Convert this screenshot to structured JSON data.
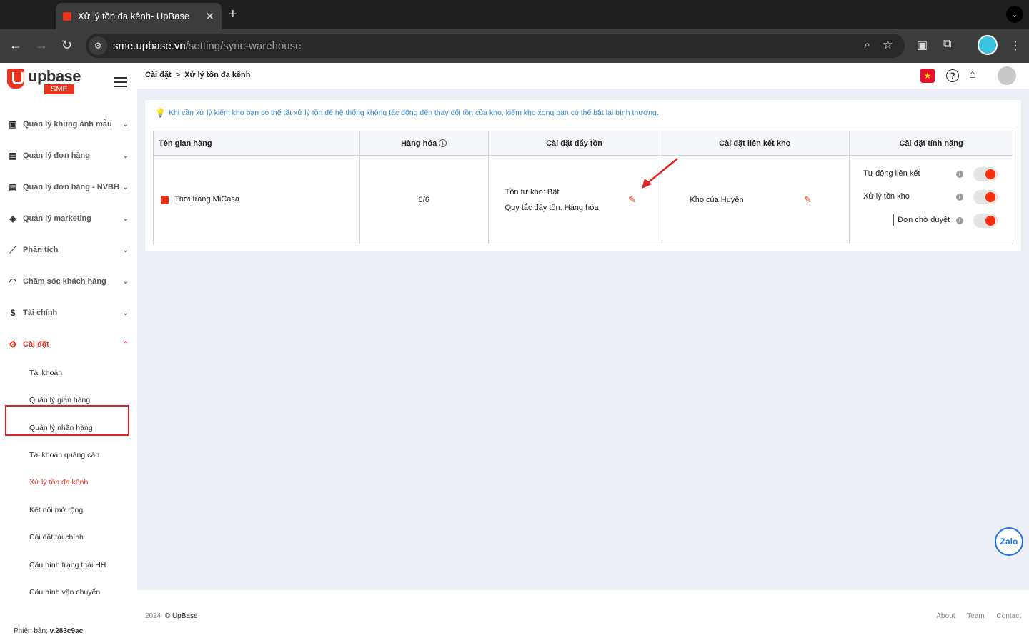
{
  "browser": {
    "tab_title": "Xử lý tồn đa kênh- UpBase",
    "url_host": "sme.upbase.vn",
    "url_path": "/setting/sync-warehouse"
  },
  "sidebar": {
    "logo_word": "upbase",
    "logo_badge": "SME",
    "menu": [
      {
        "label": "Quản lý khung ảnh mẫu",
        "icon": "frame-icon"
      },
      {
        "label": "Quản lý đơn hàng",
        "icon": "order-icon"
      },
      {
        "label": "Quản lý đơn hàng - NVBH",
        "icon": "order-icon"
      },
      {
        "label": "Quản lý marketing",
        "icon": "tag-icon"
      },
      {
        "label": "Phân tích",
        "icon": "chart-icon"
      },
      {
        "label": "Chăm sóc khách hàng",
        "icon": "headset-icon"
      },
      {
        "label": "Tài chính",
        "icon": "dollar-icon"
      },
      {
        "label": "Cài đặt",
        "icon": "gear-icon"
      }
    ],
    "submenu": [
      "Tài khoản",
      "Quản lý gian hàng",
      "Quản lý nhãn hàng",
      "Tài khoản quảng cáo",
      "Xử lý tồn đa kênh",
      "Kết nối mở rộng",
      "Cài đặt tài chính",
      "Cấu hình trạng thái HH",
      "Cấu hình vận chuyển"
    ],
    "version_label": "Phiên bản:",
    "version_value": "v.283c9ac"
  },
  "topbar": {
    "breadcrumb_parent": "Cài đặt",
    "breadcrumb_sep": ">",
    "breadcrumb_current": "Xử lý tồn đa kênh"
  },
  "main": {
    "notice": "Khi cần xử lý kiểm kho bạn có thể tắt xử lý tồn để hệ thống không tác động đến thay đổi tồn của kho, kiểm kho xong bạn có thể bật lại bình thường.",
    "table": {
      "headers": [
        "Tên gian hàng",
        "Hàng hóa",
        "Cài đặt đẩy tồn",
        "Cài đặt liên kết kho",
        "Cài đặt tính năng"
      ],
      "row": {
        "shop_name": "Thời trang MiCasa",
        "goods": "6/6",
        "push_line1": "Tồn từ kho: Bật",
        "push_line2": "Quy tắc đẩy tồn: Hàng hóa",
        "warehouse": "Kho của Huyền",
        "features": [
          {
            "label": "Tự động liên kết",
            "enabled": true
          },
          {
            "label": "Xử lý tồn kho",
            "enabled": true
          },
          {
            "label": "Đơn chờ duyệt",
            "enabled": true
          }
        ]
      }
    }
  },
  "footer": {
    "year": "2024",
    "brand": "© UpBase",
    "links": [
      "About",
      "Team",
      "Contact"
    ]
  },
  "zalo_label": "Zalo",
  "colors": {
    "accent": "#e8331f",
    "toggle_on": "#fe2c09",
    "notice": "#2e8bd8"
  }
}
